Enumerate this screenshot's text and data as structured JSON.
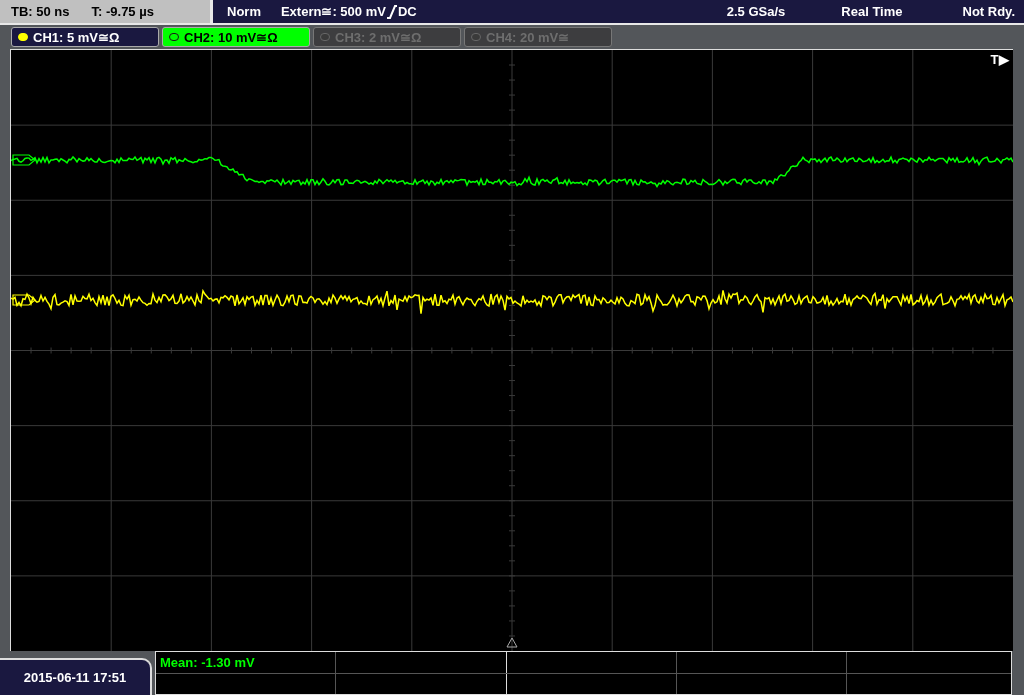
{
  "status_bar": {
    "timebase": "TB: 50 ns",
    "trigger_time": "T: -9.75 µs",
    "trigger_mode": "Norm",
    "trigger_source": "Extern≅: 500 mV",
    "coupling": "DC",
    "sample_rate": "2.5 GSa/s",
    "acquisition": "Real Time",
    "state": "Not Rdy."
  },
  "channels": [
    {
      "label": "CH1: 5 mV≅Ω",
      "on": true,
      "selected": false,
      "color": "#ffff00"
    },
    {
      "label": "CH2: 10 mV≅Ω",
      "on": true,
      "selected": true,
      "color": "#00ff00"
    },
    {
      "label": "CH3: 2 mV≅Ω",
      "on": false,
      "selected": false
    },
    {
      "label": "CH4: 20 mV≅",
      "on": false,
      "selected": false
    }
  ],
  "trigger_marker": "T▶",
  "measurements": [
    {
      "text": "Mean: -1.30 mV"
    }
  ],
  "datetime": "2015-06-11 17:51"
}
